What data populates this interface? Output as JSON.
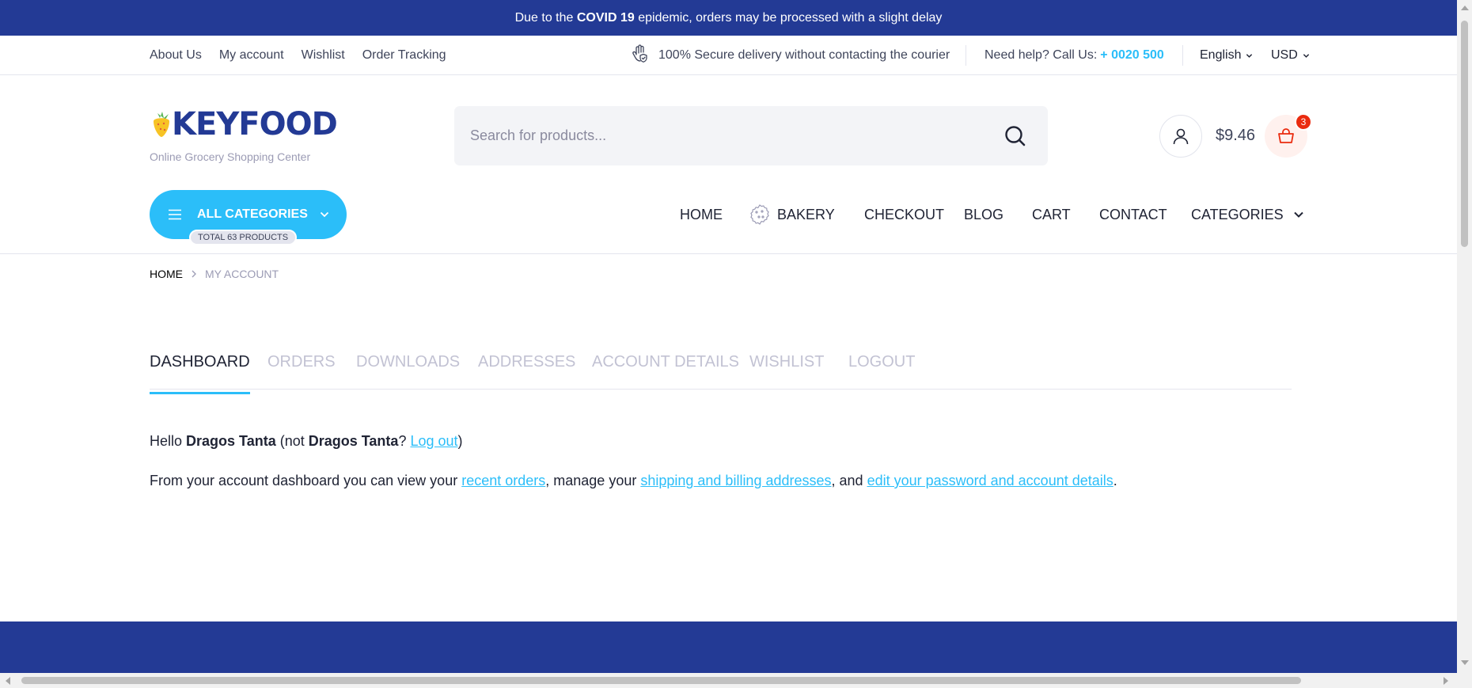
{
  "topbar": {
    "prefix": "Due to the ",
    "highlight": "COVID 19",
    "suffix": " epidemic, orders may be processed with a slight delay"
  },
  "header_top": {
    "links": [
      "About Us",
      "My account",
      "Wishlist",
      "Order Tracking"
    ],
    "secure_text": "100% Secure delivery without contacting the courier",
    "help_text": "Need help? Call Us:",
    "phone": "+ 0020 500",
    "language": "English",
    "currency": "USD"
  },
  "logo": {
    "brand": "KEYFOOD",
    "tagline": "Online Grocery Shopping Center"
  },
  "search": {
    "placeholder": "Search for products..."
  },
  "cart": {
    "price": "$9.46",
    "count": "3"
  },
  "all_categories": {
    "label": "ALL CATEGORIES",
    "total": "TOTAL 63 PRODUCTS"
  },
  "nav": {
    "items": [
      "HOME",
      "BAKERY",
      "CHECKOUT",
      "BLOG",
      "CART",
      "CONTACT",
      "CATEGORIES"
    ]
  },
  "breadcrumb": {
    "home": "HOME",
    "current": "MY ACCOUNT"
  },
  "tabs": [
    "DASHBOARD",
    "ORDERS",
    "DOWNLOADS",
    "ADDRESSES",
    "ACCOUNT DETAILS",
    "WISHLIST",
    "LOGOUT"
  ],
  "dashboard": {
    "hello": "Hello ",
    "name": "Dragos Tanta",
    "not_open": " (not ",
    "not_name": "Dragos Tanta",
    "q": "? ",
    "logout_link": "Log out",
    "close": ")",
    "intro": "From your account dashboard you can view your ",
    "recent_orders": "recent orders",
    "mid1": ", manage your ",
    "addresses_link": "shipping and billing addresses",
    "mid2": ", and ",
    "details_link": "edit your password and account details",
    "end": "."
  },
  "colors": {
    "primary_blue": "#233a95",
    "accent_cyan": "#2bbef9",
    "badge_red": "#ea2b0f"
  },
  "icons": [
    "hand-shield-icon",
    "chevron-down-icon",
    "strawberry-icon",
    "search-icon",
    "user-icon",
    "basket-icon",
    "hamburger-icon",
    "cookie-icon"
  ]
}
